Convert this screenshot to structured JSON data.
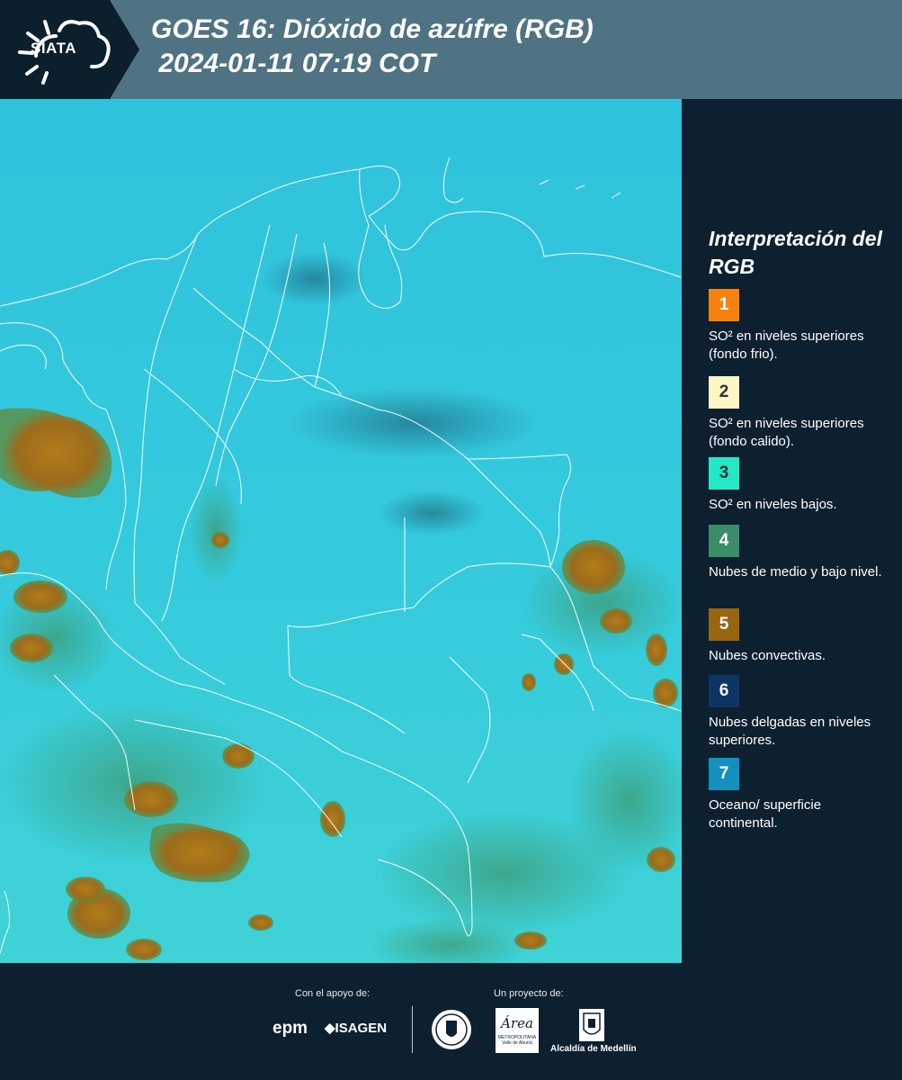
{
  "header": {
    "logo_text": "SIATA",
    "title": "GOES 16: Dióxido de azúfre (RGB)\n 2024-01-11 07:19 COT"
  },
  "legend": {
    "title": "Interpretación del RGB",
    "items": [
      {
        "number": "1",
        "color": "#f7830f",
        "text": "SO² en niveles superiores (fondo frio)."
      },
      {
        "number": "2",
        "color": "#fdf6c5",
        "text": "SO² en niveles superiores (fondo calido)."
      },
      {
        "number": "3",
        "color": "#23e8c6",
        "text": "SO² en niveles bajos."
      },
      {
        "number": "4",
        "color": "#3b8d68",
        "text": "Nubes de medio y bajo nivel."
      },
      {
        "number": "5",
        "color": "#9a6511",
        "text": "Nubes convectivas."
      },
      {
        "number": "6",
        "color": "#0d3463",
        "text": "Nubes delgadas en niveles superiores."
      },
      {
        "number": "7",
        "color": "#1490bf",
        "text": "Oceano/ superficie continental."
      }
    ]
  },
  "footer": {
    "support_label": "Con el apoyo de:",
    "project_label": "Un proyecto de:",
    "epm_logo": "epm",
    "isagen_logo": "ISAGEN",
    "area_logo": "Área",
    "area_sub": "METROPOLITANA",
    "area_sub2": "Valle de Aburrá",
    "alcaldia_logo": "Alcaldía de Medellín"
  },
  "colors": {
    "header_bg": "#4f7383",
    "panel_bg": "#0d2030",
    "map_base": "#2ec8dd"
  }
}
